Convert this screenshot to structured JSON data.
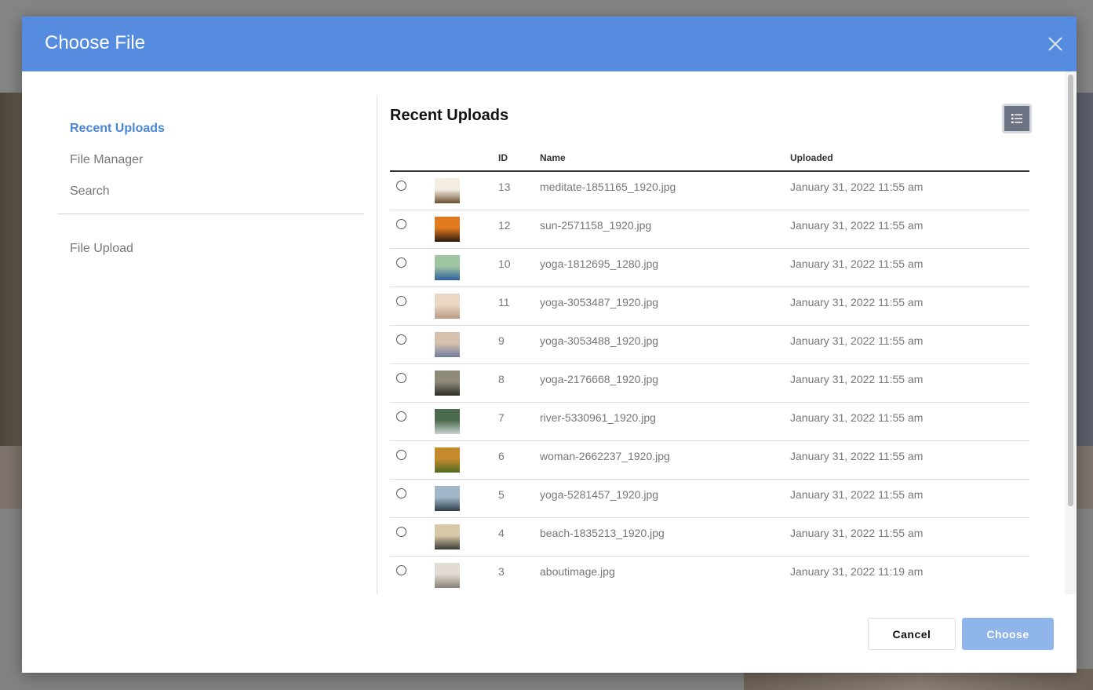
{
  "modal": {
    "title": "Choose File"
  },
  "sidebar": {
    "items": [
      {
        "label": "Recent Uploads",
        "active": true
      },
      {
        "label": "File Manager",
        "active": false
      },
      {
        "label": "Search",
        "active": false
      }
    ],
    "secondary_items": [
      {
        "label": "File Upload"
      }
    ]
  },
  "main": {
    "title": "Recent Uploads",
    "view_toggle_icon": "list-icon",
    "columns": {
      "id": "ID",
      "name": "Name",
      "uploaded": "Uploaded"
    },
    "rows": [
      {
        "id": "13",
        "name": "meditate-1851165_1920.jpg",
        "uploaded": "January 31, 2022 11:55 am",
        "thumb_colors": [
          "#f4ede2",
          "#6b4e2e"
        ]
      },
      {
        "id": "12",
        "name": "sun-2571158_1920.jpg",
        "uploaded": "January 31, 2022 11:55 am",
        "thumb_colors": [
          "#e07a1f",
          "#2a1a0c"
        ]
      },
      {
        "id": "10",
        "name": "yoga-1812695_1280.jpg",
        "uploaded": "January 31, 2022 11:55 am",
        "thumb_colors": [
          "#9fc5a0",
          "#2e5fa0"
        ]
      },
      {
        "id": "11",
        "name": "yoga-3053487_1920.jpg",
        "uploaded": "January 31, 2022 11:55 am",
        "thumb_colors": [
          "#ead8c4",
          "#b89a82"
        ]
      },
      {
        "id": "9",
        "name": "yoga-3053488_1920.jpg",
        "uploaded": "January 31, 2022 11:55 am",
        "thumb_colors": [
          "#d6c0ae",
          "#6f7c9e"
        ]
      },
      {
        "id": "8",
        "name": "yoga-2176668_1920.jpg",
        "uploaded": "January 31, 2022 11:55 am",
        "thumb_colors": [
          "#8f8a78",
          "#2d2e26"
        ]
      },
      {
        "id": "7",
        "name": "river-5330961_1920.jpg",
        "uploaded": "January 31, 2022 11:55 am",
        "thumb_colors": [
          "#4c6b4e",
          "#c8d2cf"
        ]
      },
      {
        "id": "6",
        "name": "woman-2662237_1920.jpg",
        "uploaded": "January 31, 2022 11:55 am",
        "thumb_colors": [
          "#c68a2e",
          "#4f6a22"
        ]
      },
      {
        "id": "5",
        "name": "yoga-5281457_1920.jpg",
        "uploaded": "January 31, 2022 11:55 am",
        "thumb_colors": [
          "#9fb7c8",
          "#2f3e4a"
        ]
      },
      {
        "id": "4",
        "name": "beach-1835213_1920.jpg",
        "uploaded": "January 31, 2022 11:55 am",
        "thumb_colors": [
          "#d6c8a8",
          "#3c3a32"
        ]
      },
      {
        "id": "3",
        "name": "aboutimage.jpg",
        "uploaded": "January 31, 2022 11:19 am",
        "thumb_colors": [
          "#e2dcd4",
          "#8a8279"
        ]
      }
    ]
  },
  "footer": {
    "cancel_label": "Cancel",
    "choose_label": "Choose"
  },
  "colors": {
    "header": "#568ce0",
    "active_nav": "#4a86d6",
    "choose_button": "#8fb5ea"
  }
}
